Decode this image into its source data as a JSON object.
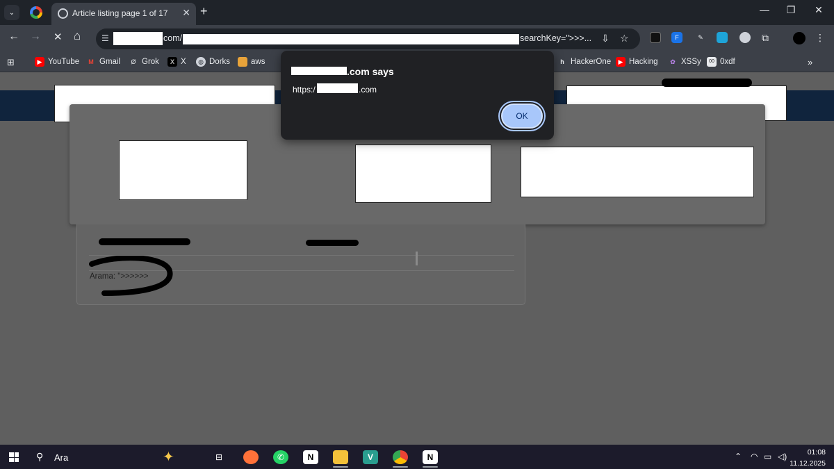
{
  "browser": {
    "tab_title": "Article listing page 1 of 17",
    "tab_close": "✕",
    "new_tab": "+",
    "window_controls": [
      "—",
      "❐",
      "✕"
    ],
    "tab_list": "⌄"
  },
  "toolbar": {
    "back": "←",
    "forward": "→",
    "stop": "✕",
    "home": "⌂",
    "url_mid": "com/",
    "url_end": "searchKey=\">>>..."
  },
  "bookmarks": [
    {
      "label": "YouTube",
      "icon": "youtube-icon"
    },
    {
      "label": "Gmail",
      "icon": "gmail-icon"
    },
    {
      "label": "Grok",
      "icon": "grok-icon"
    },
    {
      "label": "X",
      "icon": "x-icon"
    },
    {
      "label": "Dorks",
      "icon": "globe-icon"
    },
    {
      "label": "aws",
      "icon": "aws-icon"
    },
    {
      "label": "HackerOne",
      "icon": "hackerone-icon"
    },
    {
      "label": "Hacking",
      "icon": "youtube-icon"
    },
    {
      "label": "XSSy",
      "icon": "xssy-icon"
    },
    {
      "label": "0xdf",
      "icon": "0xdf-icon"
    }
  ],
  "dialog": {
    "title_suffix": ".com says",
    "message_prefix": "https:/",
    "message_suffix": ".com",
    "ok_label": "OK"
  },
  "page": {
    "search_text": "Arama: \">>>>>>"
  },
  "taskbar": {
    "search_placeholder": "Ara",
    "time": "01:08",
    "date": "11.12.2025"
  },
  "colors": {
    "chrome_dark": "#1f2329",
    "chrome_mid": "#3c4048",
    "dialog_bg": "#202124",
    "ok_button": "#a8c7fa",
    "page_header": "#10243d",
    "taskbar": "#1c1b2b"
  }
}
